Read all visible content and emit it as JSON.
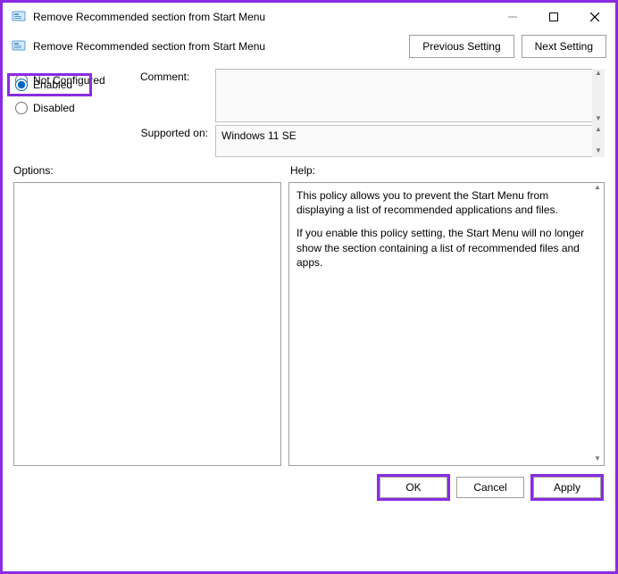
{
  "window": {
    "title": "Remove Recommended section from Start Menu"
  },
  "toolbar": {
    "title": "Remove Recommended section from Start Menu",
    "prev_label": "Previous Setting",
    "next_label": "Next Setting"
  },
  "state": {
    "radios": {
      "not_configured_label": "Not Configured",
      "enabled_label": "Enabled",
      "disabled_label": "Disabled",
      "selected": "enabled"
    },
    "comment_label": "Comment:",
    "comment_value": "",
    "supported_label": "Supported on:",
    "supported_value": "Windows 11 SE"
  },
  "lower": {
    "options_label": "Options:",
    "help_label": "Help:",
    "options_body": "",
    "help_body_p1": "This policy allows you to prevent the Start Menu from displaying a list of recommended applications and files.",
    "help_body_p2": "If you enable this policy setting, the Start Menu will no longer show the section containing a list of recommended files and apps."
  },
  "buttons": {
    "ok": "OK",
    "cancel": "Cancel",
    "apply": "Apply"
  }
}
